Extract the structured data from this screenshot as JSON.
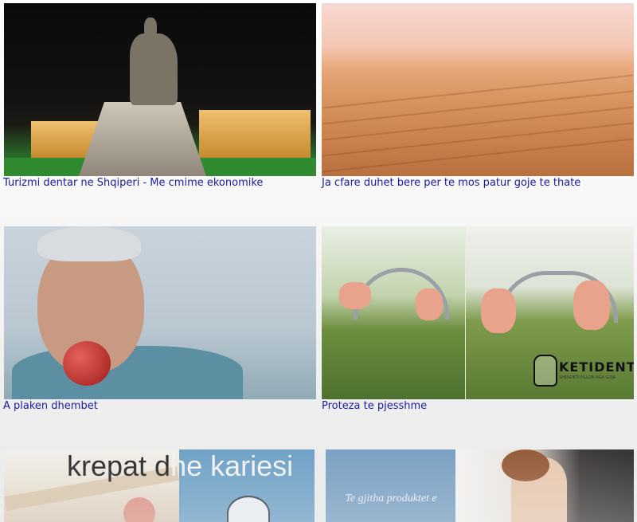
{
  "articles": [
    {
      "title": "Turizmi dentar ne Shqiperi - Me cmime ekonomike",
      "image": "night-statue-plaza"
    },
    {
      "title": "Ja cfare duhet bere per te mos patur goje te thate",
      "image": "desert-dunes"
    },
    {
      "title": "A plaken dhembet",
      "image": "man-eating-apple"
    },
    {
      "title": "Proteza te pjesshme",
      "image": "partial-dentures",
      "logo": {
        "name": "KETIDENT",
        "tagline": "SHENDETI FILLON NGA GOJA"
      }
    }
  ],
  "bottom_row": {
    "heading_dark": "krepat d",
    "heading_light": "he kariesi",
    "promo_text": "Te gjitha produktet e"
  }
}
